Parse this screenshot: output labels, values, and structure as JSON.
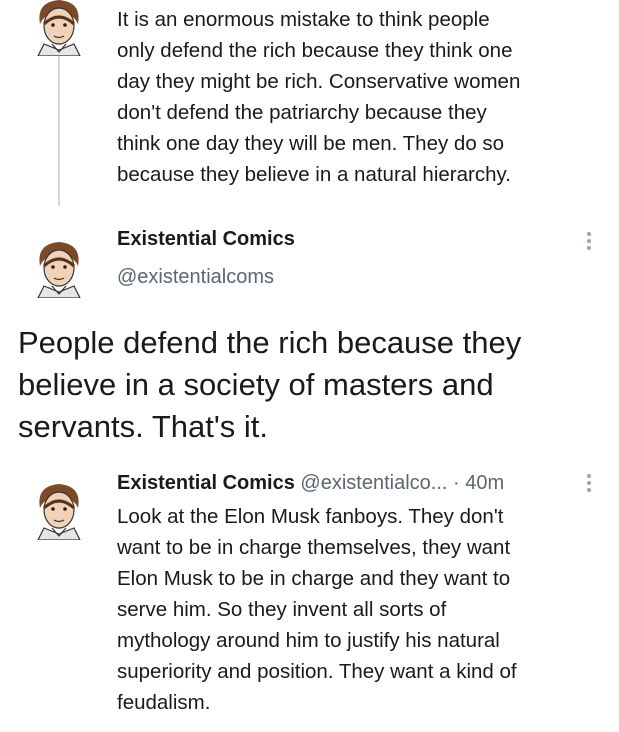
{
  "thread": {
    "top_tweet": {
      "text": "It is an enormous mistake to think people\nonly defend the rich because they think one\nday they might be rich. Conservative women\ndon't defend the patriarchy because they\nthink one day they will be men. They do so\nbecause they believe in a natural hierarchy."
    },
    "main_tweet": {
      "author_name": "Existential Comics",
      "author_handle": "@existentialcoms",
      "text": "People defend the rich because they believe in a society of masters and servants. That's it."
    },
    "reply_tweet": {
      "author_name": "Existential Comics",
      "author_handle": "@existentialco...",
      "separator": "·",
      "time": "40m",
      "text": "Look at the Elon Musk fanboys. They don't\nwant to be in charge themselves, they want\nElon Musk to be in charge and they want to\nserve him. So they invent all sorts of\nmythology around him to justify his natural\nsuperiority and position. They want a kind of\nfeudalism."
    }
  },
  "icons": {
    "avatar": "cartoon-portrait-avatar",
    "more": "vertical-ellipsis-icon"
  },
  "colors": {
    "text": "#1a1a1a",
    "secondary_text": "#5b6670",
    "thread_line": "#cfd6dc",
    "more_icon": "#9aa5ae"
  }
}
